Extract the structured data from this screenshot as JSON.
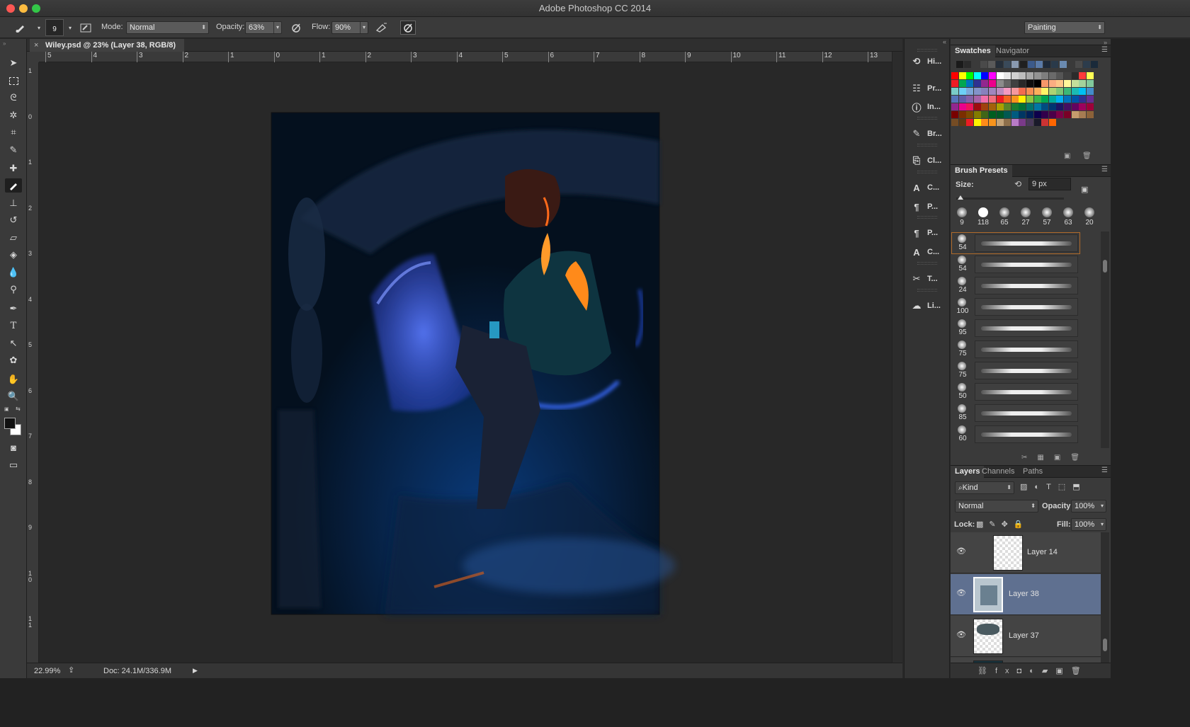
{
  "window": {
    "title": "Adobe Photoshop CC 2014"
  },
  "options_bar": {
    "brush_size": "9",
    "mode_label": "Mode:",
    "mode_value": "Normal",
    "opacity_label": "Opacity:",
    "opacity_value": "63%",
    "flow_label": "Flow:",
    "flow_value": "90%",
    "workspace": "Painting"
  },
  "document": {
    "tab_title": "Wiley.psd @ 23% (Layer 38, RGB/8)",
    "ruler_h": [
      "5",
      "4",
      "3",
      "2",
      "1",
      "0",
      "1",
      "2",
      "3",
      "4",
      "5",
      "6",
      "7",
      "8",
      "9",
      "10",
      "11",
      "12",
      "13"
    ],
    "ruler_v": [
      "1",
      "0",
      "1",
      "2",
      "3",
      "4",
      "5",
      "6",
      "7",
      "8",
      "9",
      "10",
      "11"
    ]
  },
  "status": {
    "zoom": "22.99%",
    "doc_size": "Doc: 24.1M/336.9M"
  },
  "icon_panel": [
    {
      "icon": "history-icon",
      "label": "Hi..."
    },
    {
      "icon": "properties-icon",
      "label": "Pr..."
    },
    {
      "icon": "info-icon",
      "label": "In..."
    },
    {
      "icon": "brush-icon",
      "label": "Br..."
    },
    {
      "icon": "clone-source-icon",
      "label": "Cl..."
    },
    {
      "icon": "character-icon",
      "label": "C..."
    },
    {
      "icon": "paragraph-icon",
      "label": "P..."
    },
    {
      "icon": "paragraph-styles-icon",
      "label": "P..."
    },
    {
      "icon": "character-styles-icon",
      "label": "C..."
    },
    {
      "icon": "tool-presets-icon",
      "label": "T..."
    },
    {
      "icon": "libraries-icon",
      "label": "Li..."
    }
  ],
  "swatches_panel": {
    "tabs": [
      "Swatches",
      "Navigator"
    ],
    "row0": [
      "#1a1a1a",
      "#2a2a2a",
      "#3a3a3a",
      "#4a4a4a",
      "#5a5a5a",
      "#262f3a",
      "#3a4a5a",
      "#8a9ab0",
      "#202020",
      "#3c5a8a",
      "#5a7aa8",
      "#1e2a3a",
      "#2a3a4a",
      "#6a8ab0",
      "#3a3a3a",
      "#4a4a4a",
      "#2c3c4c",
      "#1a2a3a"
    ],
    "rows": [
      [
        "#ff0000",
        "#ffff00",
        "#00ff00",
        "#00ffff",
        "#0000ff",
        "#ff00ff",
        "#ffffff",
        "#e6e6e6",
        "#d0d0d0",
        "#bdbdbd",
        "#a8a8a8",
        "#939393",
        "#7e7e7e",
        "#6a6a6a",
        "#555555",
        "#404040",
        "#2b2b2b",
        "#ff3a3a",
        "#ffff55"
      ],
      [
        "#ee1c24",
        "#00a651",
        "#0072bc",
        "#2e3192",
        "#92278f",
        "#ec008c",
        "#8c8c8c",
        "#656565",
        "#404040",
        "#282828",
        "#0e0e0e",
        "#000000",
        "#f7976a",
        "#fbad82",
        "#fdc689",
        "#fff79a",
        "#c4df9b",
        "#a3d39c",
        "#82ca9c"
      ],
      [
        "#7accc8",
        "#6dcff6",
        "#7da7d9",
        "#8393ca",
        "#8781bd",
        "#a186be",
        "#bd8cbf",
        "#f49ac1",
        "#f5989d",
        "#f26c4f",
        "#f68e55",
        "#fbaf5c",
        "#fff467",
        "#acd373",
        "#7cc576",
        "#3bb878",
        "#1abbb4",
        "#00bff3",
        "#438cca"
      ],
      [
        "#5574b9",
        "#605ca8",
        "#855fa8",
        "#a763a8",
        "#f06eaa",
        "#f26d7d",
        "#ed1c24",
        "#f26522",
        "#f7941d",
        "#fff200",
        "#8dc63f",
        "#39b54a",
        "#00a651",
        "#00a99d",
        "#00aeef",
        "#0072bc",
        "#0054a6",
        "#2e3192",
        "#662d91"
      ],
      [
        "#92278f",
        "#ec008c",
        "#ed145b",
        "#9e0b0f",
        "#a0410d",
        "#a3620a",
        "#aba000",
        "#598527",
        "#197b30",
        "#007236",
        "#00746b",
        "#0076a3",
        "#004b80",
        "#003471",
        "#1b1464",
        "#440e62",
        "#630460",
        "#9e005d",
        "#9e0039"
      ],
      [
        "#790000",
        "#7b2e00",
        "#7d4900",
        "#827b00",
        "#406618",
        "#005e20",
        "#005826",
        "#005952",
        "#005b7f",
        "#003663",
        "#002157",
        "#0d004c",
        "#32004b",
        "#4b0049",
        "#7b0046",
        "#7a0026",
        "#c69c6d",
        "#a67c52",
        "#8c6239"
      ],
      [
        "#754c24",
        "#603913",
        "#ed1c24",
        "#fff200",
        "#ff8c1a",
        "#f7941d",
        "#c2a37a",
        "#8d6f4b",
        "#b87bc7",
        "#7a3a8a",
        "#4a3a5a",
        "#1a1a2a",
        "#cc3333",
        "#ff6600"
      ]
    ]
  },
  "brush_presets": {
    "tab": "Brush Presets",
    "size_label": "Size:",
    "size_value": "9 px",
    "top_row": [
      "9",
      "118",
      "65",
      "27",
      "57",
      "63",
      "20"
    ],
    "list": [
      "54",
      "54",
      "24",
      "100",
      "95",
      "75",
      "75",
      "50",
      "85",
      "60"
    ]
  },
  "layers_panel": {
    "tabs": [
      "Layers",
      "Channels",
      "Paths"
    ],
    "kind_label": "Kind",
    "blend_mode": "Normal",
    "opacity_label": "Opacity:",
    "opacity_value": "100%",
    "lock_label": "Lock:",
    "fill_label": "Fill:",
    "fill_value": "100%",
    "layers": [
      {
        "name": "Layer 14"
      },
      {
        "name": "Layer 38"
      },
      {
        "name": "Layer 37"
      }
    ]
  }
}
